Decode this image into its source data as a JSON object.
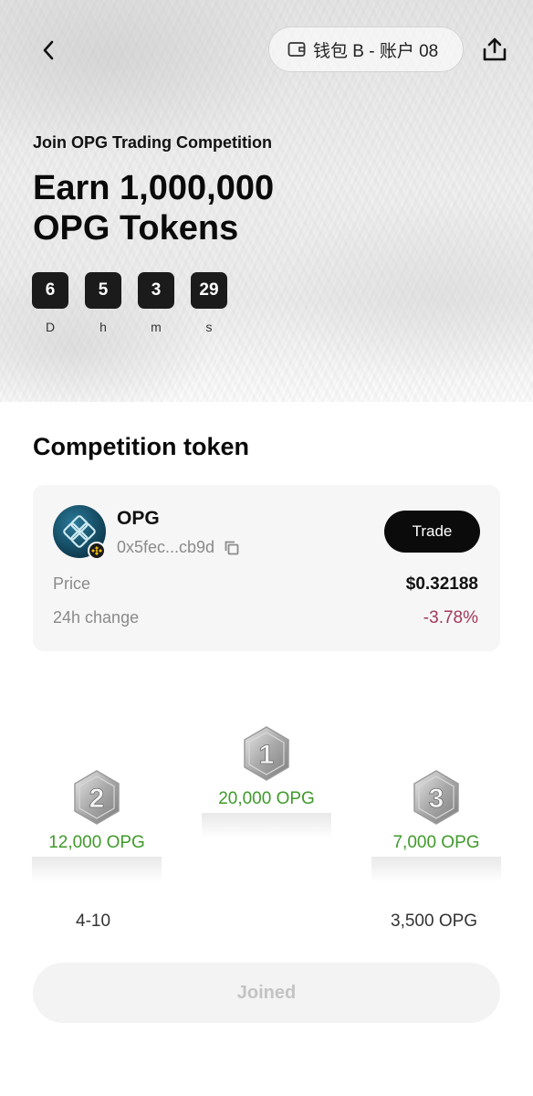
{
  "header": {
    "wallet_label": "钱包 B - 账户 08"
  },
  "hero": {
    "subtitle": "Join OPG Trading Competition",
    "headline_line1": "Earn 1,000,000",
    "headline_line2": "OPG Tokens",
    "countdown": [
      {
        "value": "6",
        "label": "D"
      },
      {
        "value": "5",
        "label": "h"
      },
      {
        "value": "3",
        "label": "m"
      },
      {
        "value": "29",
        "label": "s"
      }
    ]
  },
  "competition_token": {
    "section_title": "Competition token",
    "name": "OPG",
    "address": "0x5fec...cb9d",
    "trade_label": "Trade",
    "price_label": "Price",
    "price_value": "$0.32188",
    "change_label": "24h change",
    "change_value": "-3.78%",
    "change_color": "#a3385a"
  },
  "prizes": {
    "first": {
      "rank": "1",
      "amount": "20,000 OPG"
    },
    "second": {
      "rank": "2",
      "amount": "12,000 OPG"
    },
    "third": {
      "rank": "3",
      "amount": "7,000 OPG"
    },
    "range_rank": "4-10",
    "range_amount": "3,500 OPG",
    "amount_color": "#3f9a2a"
  },
  "footer": {
    "joined_label": "Joined"
  }
}
